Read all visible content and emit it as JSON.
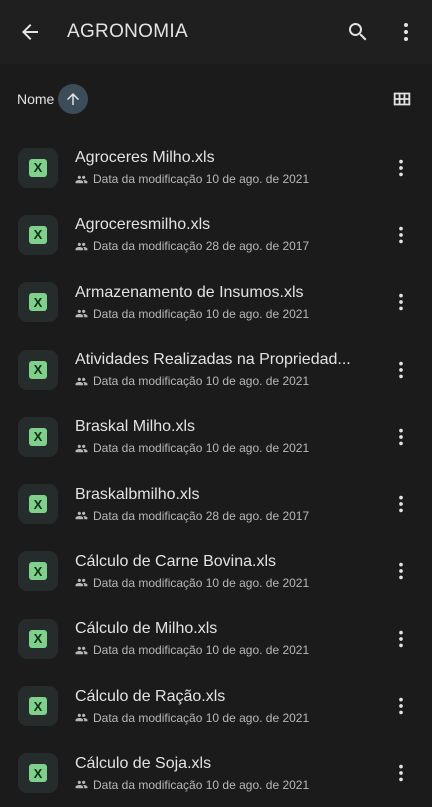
{
  "header": {
    "title": "AGRONOMIA"
  },
  "sort": {
    "label": "Nome"
  },
  "files": [
    {
      "name": "Agroceres Milho.xls",
      "meta": "Data da modificação 10 de ago. de 2021"
    },
    {
      "name": "Agroceresmilho.xls",
      "meta": "Data da modificação 28 de ago. de 2017"
    },
    {
      "name": "Armazenamento de Insumos.xls",
      "meta": "Data da modificação 10 de ago. de 2021"
    },
    {
      "name": "Atividades Realizadas na Propriedad...",
      "meta": "Data da modificação 10 de ago. de 2021"
    },
    {
      "name": "Braskal Milho.xls",
      "meta": "Data da modificação 10 de ago. de 2021"
    },
    {
      "name": "Braskalbmilho.xls",
      "meta": "Data da modificação 28 de ago. de 2017"
    },
    {
      "name": "Cálculo de Carne Bovina.xls",
      "meta": "Data da modificação 10 de ago. de 2021"
    },
    {
      "name": "Cálculo de Milho.xls",
      "meta": "Data da modificação 10 de ago. de 2021"
    },
    {
      "name": "Cálculo de Ração.xls",
      "meta": "Data da modificação 10 de ago. de 2021"
    },
    {
      "name": "Cálculo de Soja.xls",
      "meta": "Data da modificação 10 de ago. de 2021"
    }
  ],
  "file_icon_letter": "X",
  "icons": {
    "back": "arrow-back-icon",
    "search": "search-icon",
    "more": "more-vert-icon",
    "sort": "arrow-up-icon",
    "grid": "grid-view-icon",
    "file": "spreadsheet-icon",
    "shared": "people-icon"
  },
  "colors": {
    "background": "#1b1b1b",
    "text": "#e3e3e3",
    "secondary_text": "#b8b8b8",
    "sort_chip": "#3c4d59",
    "file_icon": "#7ed18b"
  }
}
